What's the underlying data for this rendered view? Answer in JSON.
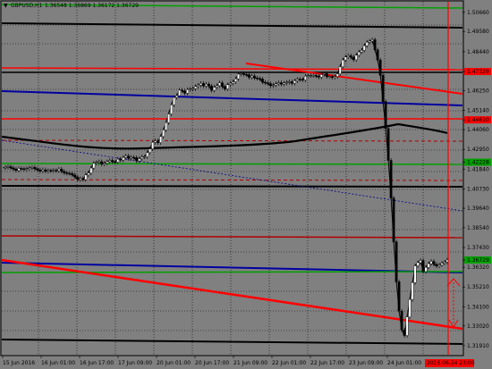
{
  "header": {
    "symbol": "GBPUSD,H1",
    "ohlc": "1.36548 1.36869 1.36172 1.36729"
  },
  "price_axis": {
    "labels": [
      "1.50660",
      "1.49580",
      "1.48440",
      "1.47329",
      "1.46250",
      "1.45140",
      "1.44610",
      "1.44060",
      "1.42950",
      "1.42228",
      "1.41840",
      "1.40730",
      "1.39640",
      "1.38540",
      "1.37430",
      "1.36729",
      "1.36320",
      "1.35210",
      "1.34100",
      "1.33020",
      "1.31910"
    ],
    "highlighted": [
      "1.47329",
      "1.44610",
      "1.42228",
      "1.36729"
    ]
  },
  "time_axis": {
    "labels": [
      "15 Jun 2016",
      "16 Jun 01:00",
      "16 Jun 17:00",
      "17 Jun 09:00",
      "20 Jun 01:00",
      "20 Jun 17:00",
      "21 Jun 09:00",
      "22 Jun 01:00",
      "22 Jun 17:00",
      "23 Jun 09:00",
      "24 Jun 01:00"
    ],
    "current_time": "2016.06.24 23:00"
  },
  "chart_data": {
    "type": "candlestick",
    "symbol": "GBPUSD",
    "timeframe": "H1",
    "ylim": [
      1.314,
      1.511
    ],
    "close": [
      1.4191,
      1.4194,
      1.4198,
      1.4191,
      1.4185,
      1.4177,
      1.4188,
      1.4186,
      1.4183,
      1.4187,
      1.4191,
      1.4194,
      1.4186,
      1.418,
      1.4173,
      1.418,
      1.4172,
      1.4176,
      1.4175,
      1.4177,
      1.4175,
      1.4184,
      1.4171,
      1.4163,
      1.416,
      1.4159,
      1.4151,
      1.4139,
      1.4125,
      1.4131,
      1.4125,
      1.4151,
      1.4162,
      1.419,
      1.4217,
      1.4221,
      1.4226,
      1.4212,
      1.4217,
      1.4226,
      1.4233,
      1.4225,
      1.4223,
      1.424,
      1.4235,
      1.4249,
      1.4258,
      1.4244,
      1.425,
      1.4249,
      1.423,
      1.4243,
      1.4253,
      1.4253,
      1.4277,
      1.4298,
      1.4335,
      1.4343,
      1.4333,
      1.4367,
      1.4404,
      1.4445,
      1.4494,
      1.4545,
      1.4587,
      1.4597,
      1.4628,
      1.4624,
      1.4611,
      1.4631,
      1.4634,
      1.4636,
      1.4649,
      1.4656,
      1.4666,
      1.4652,
      1.4662,
      1.4651,
      1.4627,
      1.4645,
      1.4653,
      1.4669,
      1.4649,
      1.4635,
      1.4659,
      1.4667,
      1.4675,
      1.4692,
      1.4718,
      1.4722,
      1.4717,
      1.4715,
      1.47,
      1.4708,
      1.4697,
      1.4694,
      1.4691,
      1.4673,
      1.4669,
      1.4665,
      1.4653,
      1.4657,
      1.4664,
      1.467,
      1.4662,
      1.4668,
      1.4672,
      1.4675,
      1.4667,
      1.4681,
      1.4689,
      1.4688,
      1.4685,
      1.4707,
      1.4709,
      1.471,
      1.4711,
      1.4707,
      1.4701,
      1.4716,
      1.4721,
      1.4704,
      1.4704,
      1.4699,
      1.4705,
      1.472,
      1.476,
      1.4798,
      1.4815,
      1.4822,
      1.4814,
      1.4799,
      1.4825,
      1.4843,
      1.4852,
      1.4878,
      1.4898,
      1.4904,
      1.4912,
      1.4855,
      1.4798,
      1.4712,
      1.4564,
      1.4412,
      1.4233,
      1.4021,
      1.3775,
      1.355,
      1.3385,
      1.328,
      1.3248,
      1.3352,
      1.345,
      1.3545,
      1.364,
      1.3658,
      1.367,
      1.3608,
      1.3631,
      1.3652,
      1.3665,
      1.3648,
      1.3639,
      1.3645,
      1.3655,
      1.3661,
      1.3673
    ]
  }
}
